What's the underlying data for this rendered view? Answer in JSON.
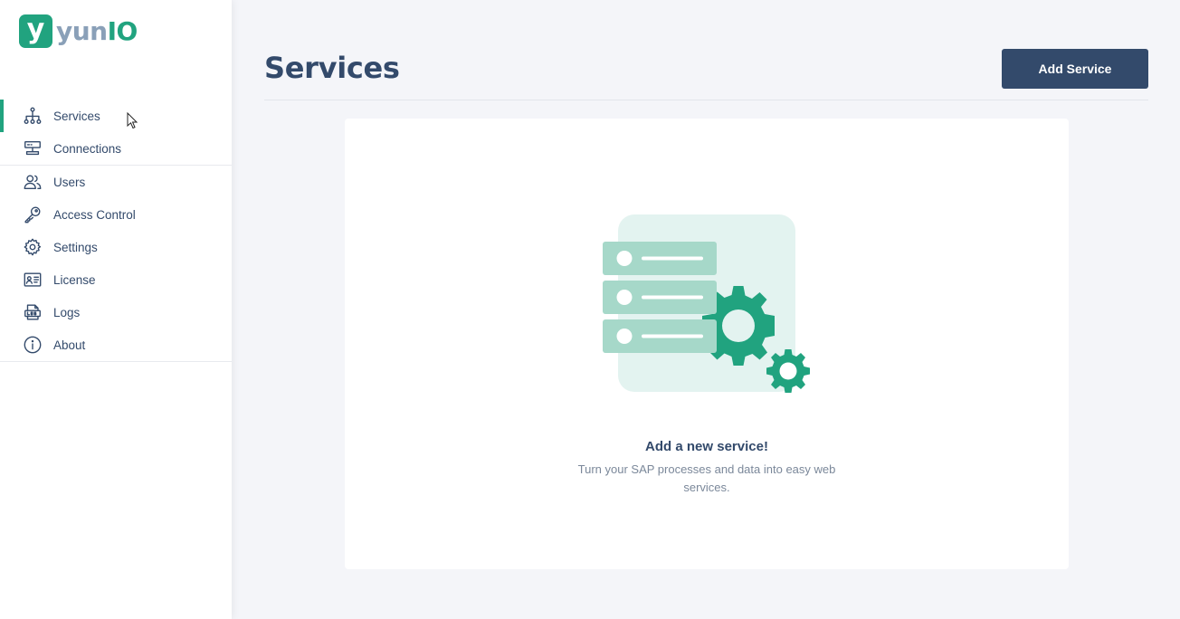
{
  "brand": {
    "mark": "y",
    "name_part1": "yun",
    "name_part2": "IO",
    "color": "#21a37f"
  },
  "sidebar": {
    "items": [
      {
        "label": "Services",
        "icon": "sitemap-icon",
        "active": true
      },
      {
        "label": "Connections",
        "icon": "connection-icon"
      },
      {
        "label": "Users",
        "icon": "users-icon"
      },
      {
        "label": "Access Control",
        "icon": "key-icon"
      },
      {
        "label": "Settings",
        "icon": "gear-icon"
      },
      {
        "label": "License",
        "icon": "id-card-icon"
      },
      {
        "label": "Logs",
        "icon": "logs-icon"
      },
      {
        "label": "About",
        "icon": "info-icon"
      }
    ]
  },
  "header": {
    "title": "Services",
    "add_button_label": "Add Service"
  },
  "empty_state": {
    "title": "Add a new service!",
    "subtitle": "Turn your SAP processes and data into easy web services.",
    "illustration": "servers-with-gears-illustration"
  },
  "colors": {
    "accent": "#21a37f",
    "primary": "#334a6b",
    "background": "#f4f5f9"
  }
}
